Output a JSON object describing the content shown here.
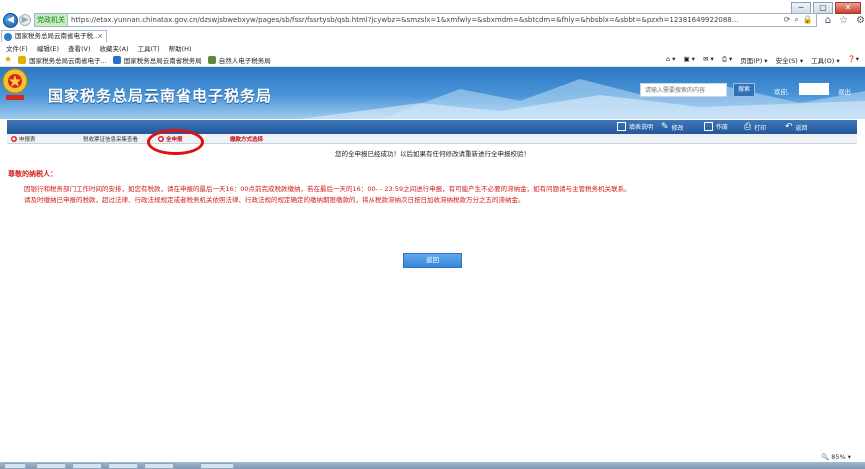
{
  "browser": {
    "cert_label": "党政机关",
    "url": "https://etax.yunnan.chinatax.gov.cn/dzswjsbwebxyw/pages/sb/fssr/fssrtysb/qsb.html?jcywbz=&smzslx=1&xmfwly=&sbxmdm=&sbtcdm=&fhly=&hbsblx=&sbbt=&pzxh=12381649922088...",
    "tab_title": "国家税务总局云南省电子税...",
    "menu": [
      "文件(F)",
      "编辑(E)",
      "查看(V)",
      "收藏夹(A)",
      "工具(T)",
      "帮助(H)"
    ],
    "favorites": [
      "国家税务总局云南省电子...",
      "国家税务总局云南省税务局",
      "自然人电子税务局"
    ],
    "tools": [
      "页面(P) ▾",
      "安全(S) ▾",
      "工具(O) ▾"
    ],
    "zoom": "85%",
    "colors": {
      "cert_bg": "#c7f0c2",
      "banner": "#2e77c4"
    }
  },
  "header": {
    "site_title": "国家税务总局云南省电子税务局",
    "search_placeholder": "请输入需要搜索的内容",
    "search_button": "搜索",
    "welcome": "欢迎,",
    "logout": "退出"
  },
  "toolbar": {
    "buttons": [
      "填表说明",
      "修改",
      "作废",
      "打印",
      "返回"
    ]
  },
  "steps": [
    {
      "label": "申报表",
      "status": "done"
    },
    {
      "label": "税收票证信息采集查看",
      "status": "done"
    },
    {
      "label": "全申报",
      "status": "current"
    },
    {
      "label": "缴款方式选择",
      "status": "pending"
    }
  ],
  "content": {
    "success_msg": "您的全申报已经成功！以后如果有任何修改请重新进行全申报校验！",
    "notice_heading": "尊敬的纳税人：",
    "notice_line1": "因银行和税务部门工作时间的安排，如您有税款，请在申报的最后一天16：00点前完成税款缴纳，若在最后一天的16：00- - 23:59之间进行申报，有可能产生不必要的滞纳金，如有问题请与主管税务机关联系。",
    "notice_line2": "请及时缴纳已申报的税款，超过法律、行政法规规定或者税务机关依照法律、行政法规的规定确定的缴纳期限缴款的，将从税款滞纳次日按日加收滞纳税款万分之五的滞纳金。",
    "return_button": "返回"
  },
  "accent_colors": {
    "notice_red": "#d31a1a",
    "primary_blue": "#3487d8"
  }
}
